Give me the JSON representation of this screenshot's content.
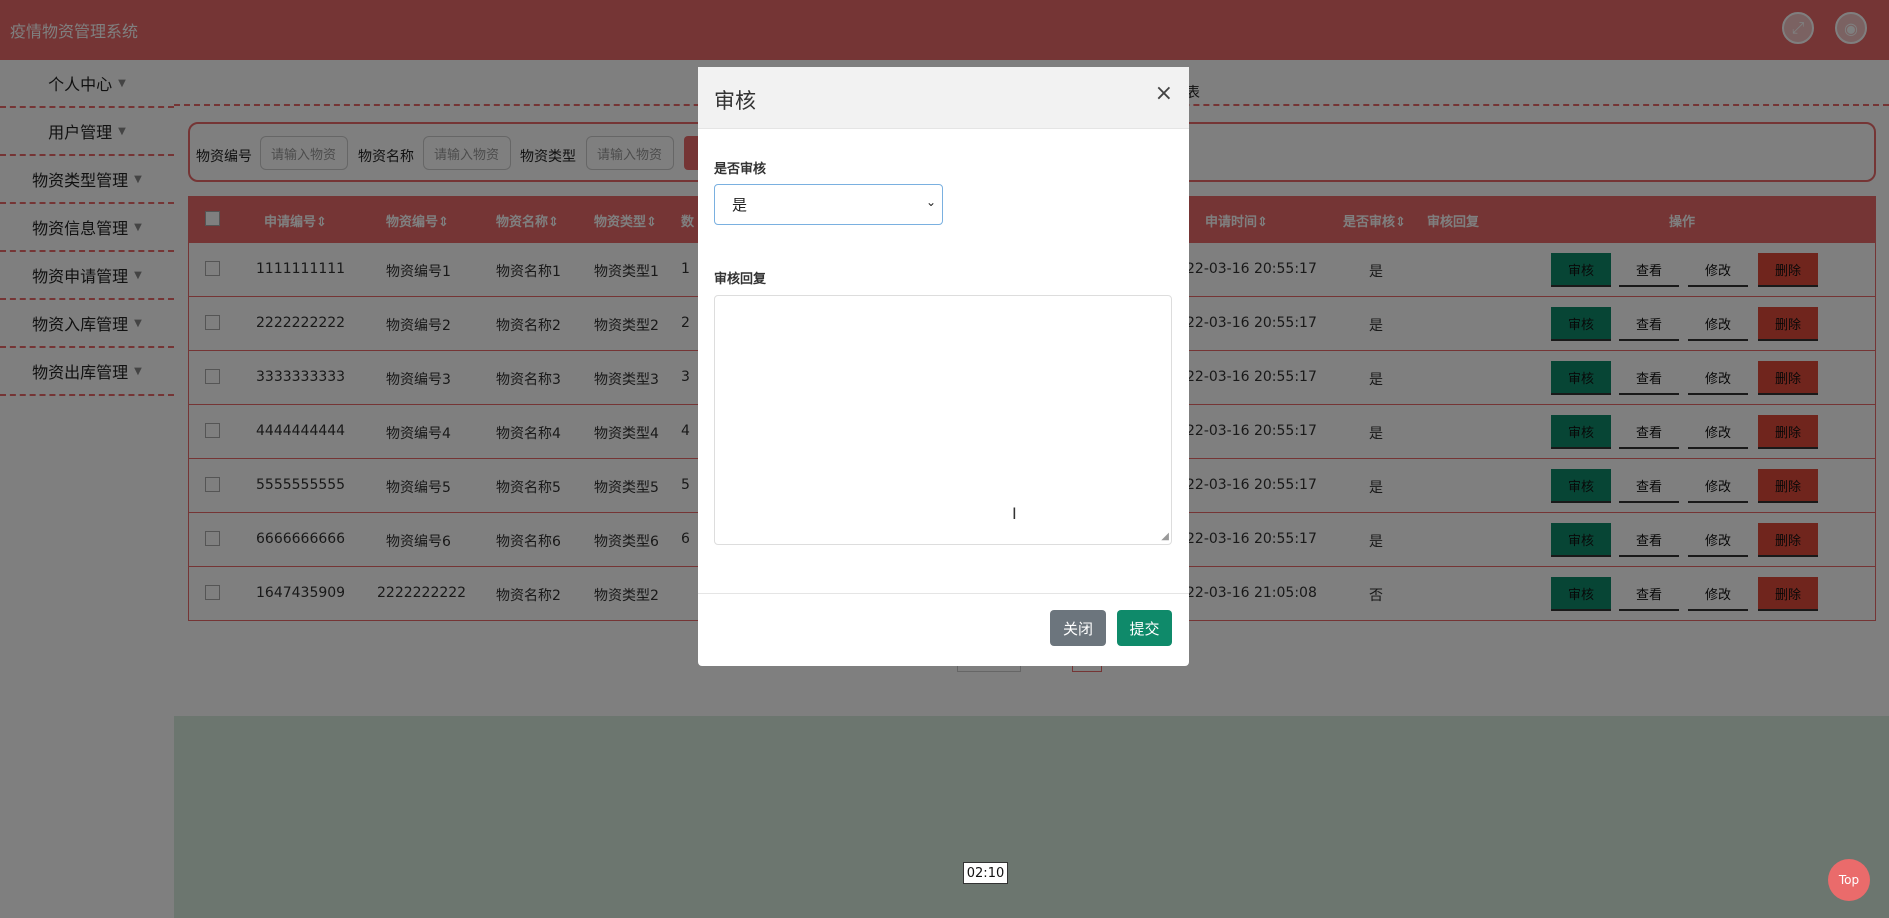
{
  "app": {
    "title": "疫情物资管理系统"
  },
  "sidebar": {
    "items": [
      {
        "label": "个人中心"
      },
      {
        "label": "用户管理"
      },
      {
        "label": "物资类型管理"
      },
      {
        "label": "物资信息管理"
      },
      {
        "label": "物资申请管理"
      },
      {
        "label": "物资入库管理"
      },
      {
        "label": "物资出库管理"
      }
    ]
  },
  "breadcrumb": {
    "tail": "表"
  },
  "search": {
    "fields": [
      {
        "label": "物资编号",
        "placeholder": "请输入物资"
      },
      {
        "label": "物资名称",
        "placeholder": "请输入物资"
      },
      {
        "label": "物资类型",
        "placeholder": "请输入物资"
      }
    ]
  },
  "table": {
    "headers": {
      "apply_no": "申请编号⇕",
      "code": "物资编号⇕",
      "name": "物资名称⇕",
      "type": "物资类型⇕",
      "qty": "数",
      "time": "申请时间⇕",
      "audited": "是否审核⇕",
      "reply": "审核回复",
      "ops": "操作"
    },
    "rows": [
      {
        "apply_no": "1111111111",
        "code": "物资编号1",
        "name": "物资名称1",
        "type": "物资类型1",
        "qty": "1",
        "time": "22-03-16 20:55:17",
        "audited": "是"
      },
      {
        "apply_no": "2222222222",
        "code": "物资编号2",
        "name": "物资名称2",
        "type": "物资类型2",
        "qty": "2",
        "time": "22-03-16 20:55:17",
        "audited": "是"
      },
      {
        "apply_no": "3333333333",
        "code": "物资编号3",
        "name": "物资名称3",
        "type": "物资类型3",
        "qty": "3",
        "time": "22-03-16 20:55:17",
        "audited": "是"
      },
      {
        "apply_no": "4444444444",
        "code": "物资编号4",
        "name": "物资名称4",
        "type": "物资类型4",
        "qty": "4",
        "time": "22-03-16 20:55:17",
        "audited": "是"
      },
      {
        "apply_no": "5555555555",
        "code": "物资编号5",
        "name": "物资名称5",
        "type": "物资类型5",
        "qty": "5",
        "time": "22-03-16 20:55:17",
        "audited": "是"
      },
      {
        "apply_no": "6666666666",
        "code": "物资编号6",
        "name": "物资名称6",
        "type": "物资类型6",
        "qty": "6",
        "time": "22-03-16 20:55:17",
        "audited": "是"
      },
      {
        "apply_no": "1647435909",
        "code": "2222222222",
        "name": "物资名称2",
        "type": "物资类型2",
        "qty": "",
        "time": "22-03-16 21:05:08",
        "audited": "否"
      }
    ],
    "actions": {
      "audit": "审核",
      "view": "查看",
      "edit": "修改",
      "delete": "删除"
    }
  },
  "modal": {
    "title": "审核",
    "close_glyph": "×",
    "audit_label": "是否审核",
    "audit_value": "是",
    "reply_label": "审核回复",
    "reply_value": "",
    "close_button": "关闭",
    "submit_button": "提交"
  },
  "misc": {
    "time_badge": "02:10",
    "top_button": "Top"
  },
  "colors": {
    "brand": "#ea6b6b",
    "success": "#0f8a6a",
    "danger": "#e04a3a",
    "secondary": "#6c757d"
  }
}
